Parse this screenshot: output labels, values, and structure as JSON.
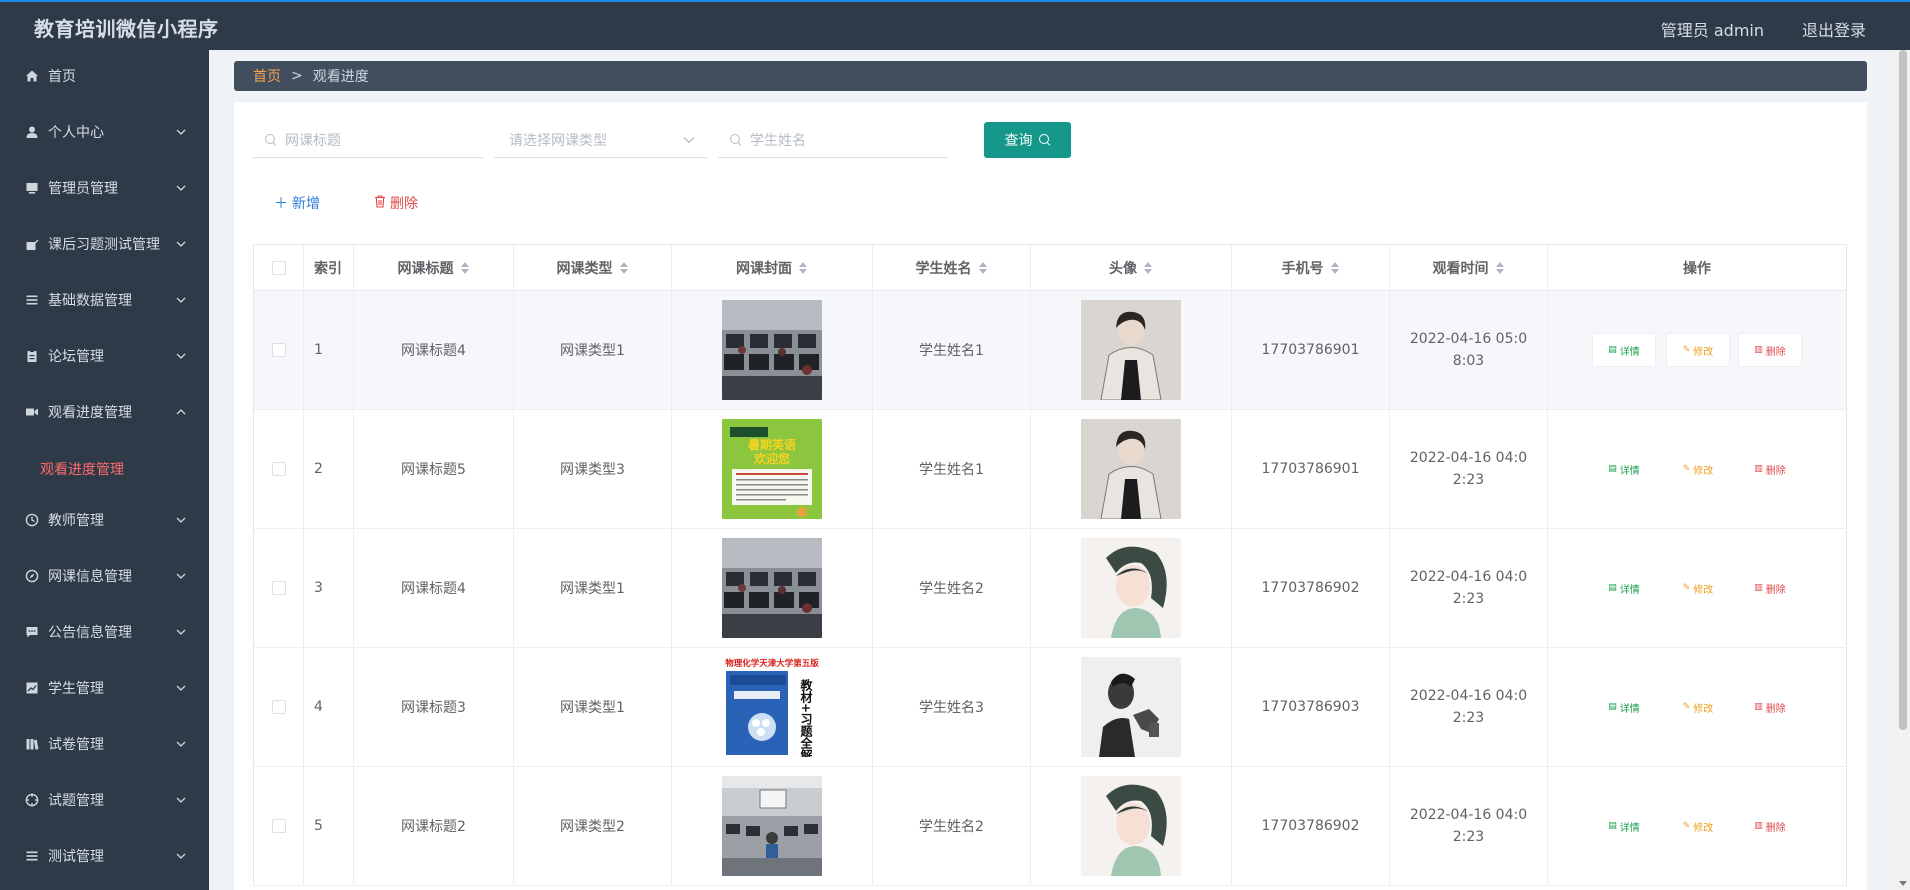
{
  "header": {
    "title": "教育培训微信小程序",
    "admin": "管理员 admin",
    "logout": "退出登录"
  },
  "sidebar": {
    "items": [
      {
        "label": "首页",
        "icon": "home-icon"
      },
      {
        "label": "个人中心",
        "icon": "user-icon"
      },
      {
        "label": "管理员管理",
        "icon": "monitor-icon"
      },
      {
        "label": "课后习题测试管理",
        "icon": "edit-icon"
      },
      {
        "label": "基础数据管理",
        "icon": "list-icon"
      },
      {
        "label": "论坛管理",
        "icon": "clipboard-icon"
      },
      {
        "label": "观看进度管理",
        "icon": "video-icon"
      },
      {
        "label": "教师管理",
        "icon": "clock-icon"
      },
      {
        "label": "网课信息管理",
        "icon": "compass-icon"
      },
      {
        "label": "公告信息管理",
        "icon": "message-icon"
      },
      {
        "label": "学生管理",
        "icon": "chart-icon"
      },
      {
        "label": "试卷管理",
        "icon": "book-icon"
      },
      {
        "label": "试题管理",
        "icon": "target-icon"
      },
      {
        "label": "测试管理",
        "icon": "list-icon"
      }
    ],
    "submenu_active": "观看进度管理"
  },
  "breadcrumb": {
    "home": "首页",
    "separator": ">",
    "current": "观看进度"
  },
  "search": {
    "title_placeholder": "网课标题",
    "type_placeholder": "请选择网课类型",
    "student_placeholder": "学生姓名",
    "button": "查询"
  },
  "actions": {
    "add": "新增",
    "delete": "删除"
  },
  "table": {
    "columns": [
      "索引",
      "网课标题",
      "网课类型",
      "网课封面",
      "学生姓名",
      "头像",
      "手机号",
      "观看时间",
      "操作"
    ],
    "op_labels": {
      "detail": "详情",
      "edit": "修改",
      "delete": "删除"
    },
    "rows": [
      {
        "index": "1",
        "title": "网课标题4",
        "type": "网课类型1",
        "cover": "classroom-computers",
        "student": "学生姓名1",
        "avatar": "man-in-coat",
        "phone": "17703786901",
        "time": "2022-04-16 05:08:03"
      },
      {
        "index": "2",
        "title": "网课标题5",
        "type": "网课类型3",
        "cover": "green-poster",
        "student": "学生姓名1",
        "avatar": "man-in-coat",
        "phone": "17703786901",
        "time": "2022-04-16 04:02:23"
      },
      {
        "index": "3",
        "title": "网课标题4",
        "type": "网课类型1",
        "cover": "classroom-computers",
        "student": "学生姓名2",
        "avatar": "anime-girl",
        "phone": "17703786902",
        "time": "2022-04-16 04:02:23"
      },
      {
        "index": "4",
        "title": "网课标题3",
        "type": "网课类型1",
        "cover": "textbook",
        "student": "学生姓名3",
        "avatar": "silhouette-man",
        "phone": "17703786903",
        "time": "2022-04-16 04:02:23"
      },
      {
        "index": "5",
        "title": "网课标题2",
        "type": "网课类型2",
        "cover": "lecture-hall",
        "student": "学生姓名2",
        "avatar": "anime-girl",
        "phone": "17703786902",
        "time": "2022-04-16 04:02:23"
      }
    ]
  },
  "book_cover_text": {
    "top": "物理化学天津大学第五版",
    "side": "教材+习题全解"
  },
  "poster_text": {
    "top": "暑期英语",
    "sub": "欢迎您"
  },
  "colors": {
    "sidebar_bg": "#2f3a48",
    "active_sub": "#ff6b6b",
    "search_button": "#15988a",
    "crumb_home": "#f5a64a"
  }
}
